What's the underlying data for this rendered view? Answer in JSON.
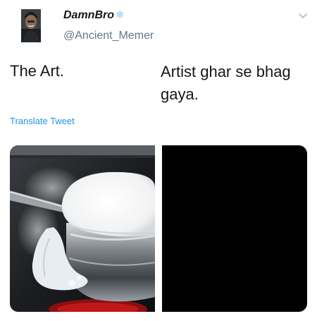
{
  "user": {
    "display_name": "DamnBro",
    "badge_glyph": "❄",
    "handle": "@Ancient_Memer"
  },
  "icons": {
    "avatar": "profile-photo",
    "menu": "chevron-down-icon",
    "badge": "snowflake-icon"
  },
  "tweet": {
    "caption_left": "The Art.",
    "caption_right": "Artist ghar se bhag gaya.",
    "translate_label": "Translate Tweet"
  },
  "media": {
    "left": "photo-pot-boiling-over",
    "right": "photo-black"
  },
  "colors": {
    "link": "#1b95e0",
    "handle": "#657786",
    "text": "#14171a",
    "badge": "#8ecde8"
  }
}
